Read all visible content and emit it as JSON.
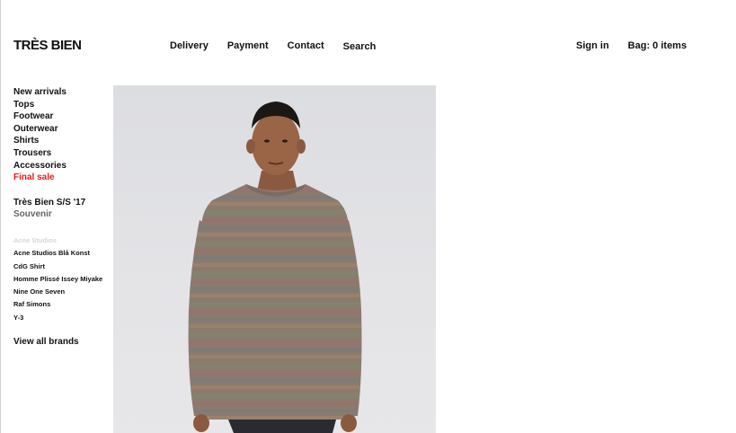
{
  "header": {
    "logo": "TRÈS BIEN",
    "nav": [
      "Delivery",
      "Payment",
      "Contact",
      "Search"
    ],
    "sign_in": "Sign in",
    "bag": "Bag: 0 items"
  },
  "sidebar": {
    "categories": [
      {
        "label": "New arrivals"
      },
      {
        "label": "Tops"
      },
      {
        "label": "Footwear"
      },
      {
        "label": "Outerwear"
      },
      {
        "label": "Shirts"
      },
      {
        "label": "Trousers"
      },
      {
        "label": "Accessories"
      },
      {
        "label": "Final sale"
      }
    ],
    "season": [
      "Très Bien S/S '17",
      "Souvenir"
    ],
    "brands": [
      "Acne Studios",
      "Acne Studios Blå Konst",
      "CdG Shirt",
      "Homme Plissé Issey Miyake",
      "Nine One Seven",
      "Raf Simons",
      "Y-3"
    ],
    "view_all": "View all brands"
  },
  "colors": {
    "sale": "#e41b17",
    "sweater": "#8a7a6c"
  }
}
